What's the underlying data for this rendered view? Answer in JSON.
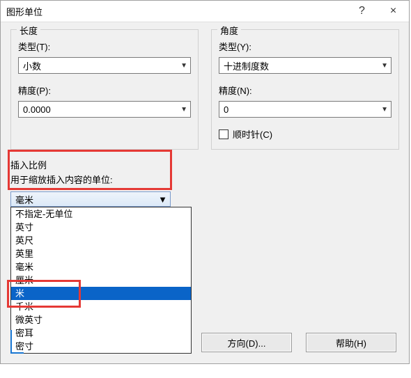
{
  "titlebar": {
    "title": "图形单位",
    "help": "?",
    "close": "×"
  },
  "length": {
    "legend": "长度",
    "type_label": "类型(T):",
    "type_value": "小数",
    "precision_label": "精度(P):",
    "precision_value": "0.0000"
  },
  "angle": {
    "legend": "角度",
    "type_label": "类型(Y):",
    "type_value": "十进制度数",
    "precision_label": "精度(N):",
    "precision_value": "0",
    "clockwise_label": "顺时针(C)"
  },
  "insert": {
    "legend": "插入比例",
    "sub": "用于缩放插入内容的单位:",
    "selected": "毫米",
    "options": [
      "不指定-无单位",
      "英寸",
      "英尺",
      "英里",
      "毫米",
      "厘米",
      "米",
      "千米",
      "微英寸",
      "密耳",
      "密寸"
    ]
  },
  "buttons": {
    "direction": "方向(D)...",
    "help": "帮助(H)"
  }
}
